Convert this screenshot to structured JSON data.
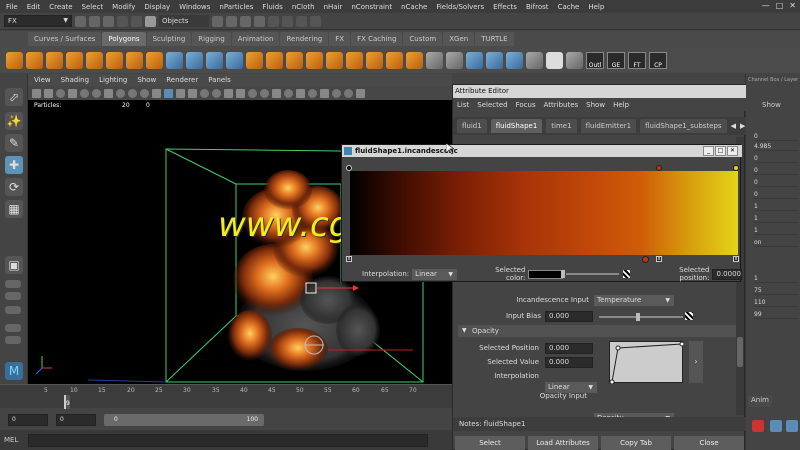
{
  "menubar": {
    "items": [
      "File",
      "Edit",
      "Create",
      "Select",
      "Modify",
      "Display",
      "Windows",
      "nParticles",
      "Fluids",
      "nCloth",
      "nHair",
      "nConstraint",
      "nCache",
      "Fields/Solvers",
      "Effects",
      "Bifrost",
      "Cache",
      "Help"
    ]
  },
  "statusline": {
    "mode": "FX",
    "selection": "Objects"
  },
  "shelf": {
    "tabs": [
      "Curves / Surfaces",
      "Polygons",
      "Sculpting",
      "Rigging",
      "Animation",
      "Rendering",
      "FX",
      "FX Caching",
      "Custom",
      "XGen",
      "TURTLE"
    ],
    "active_tab": "Polygons",
    "buttons": [
      "Outl",
      "GE",
      "FT",
      "CP"
    ]
  },
  "channel_box": {
    "header": "Channel Box / Layer Editor",
    "show_label": "Show",
    "values": [
      "0",
      "4.985",
      "0",
      "0",
      "0",
      "0",
      "1",
      "1",
      "1",
      "on",
      "1",
      "75",
      "110",
      "99"
    ],
    "anim_tab": "Anim"
  },
  "viewport": {
    "menu": [
      "View",
      "Shading",
      "Lighting",
      "Show",
      "Renderer",
      "Panels"
    ],
    "hud": {
      "label": "Particles:",
      "value_a": "20",
      "value_b": "0"
    }
  },
  "watermark": "www.cgtsj.com",
  "timeslider": {
    "ticks": [
      "5",
      "10",
      "15",
      "20",
      "25",
      "30",
      "35",
      "40",
      "45",
      "50",
      "55",
      "60",
      "65",
      "70"
    ],
    "current_frame": "9"
  },
  "rangeslider": {
    "start": "0",
    "start2": "0",
    "bar_start": "0",
    "bar_end": "100"
  },
  "cmdline": {
    "label": "MEL"
  },
  "attribute_editor": {
    "title": "Attribute Editor",
    "menu": [
      "List",
      "Selected",
      "Focus",
      "Attributes",
      "Show",
      "Help"
    ],
    "tabs": [
      "fluid1",
      "fluidShape1",
      "time1",
      "fluidEmitter1",
      "fluidShape1_substeps"
    ],
    "active_tab": "fluidShape1",
    "incandescence_input_label": "Incandescence Input",
    "incandescence_input_value": "Temperature",
    "input_bias_label": "Input Bias",
    "input_bias_value": "0.000",
    "opacity_section": "Opacity",
    "selected_position_label": "Selected Position",
    "selected_position_value": "0.000",
    "selected_value_label": "Selected Value",
    "selected_value_value": "0.000",
    "interpolation_label": "Interpolation",
    "interpolation_value": "Linear",
    "opacity_input_label": "Opacity Input",
    "opacity_input_value": "Density",
    "notes": "Notes: fluidShape1",
    "buttons": [
      "Select",
      "Load Attributes",
      "Copy Tab",
      "Close"
    ]
  },
  "ramp_window": {
    "title": "fluidShape1.incandescenc",
    "interpolation_label": "Interpolation:",
    "interpolation_value": "Linear",
    "selected_color_label": "Selected color:",
    "selected_position_label": "Selected position:",
    "selected_position_value": "0.0000"
  },
  "colors": {
    "accent": "#5e93b8",
    "watermark": "#f2ee1a",
    "bbox": "#3fd06a"
  }
}
